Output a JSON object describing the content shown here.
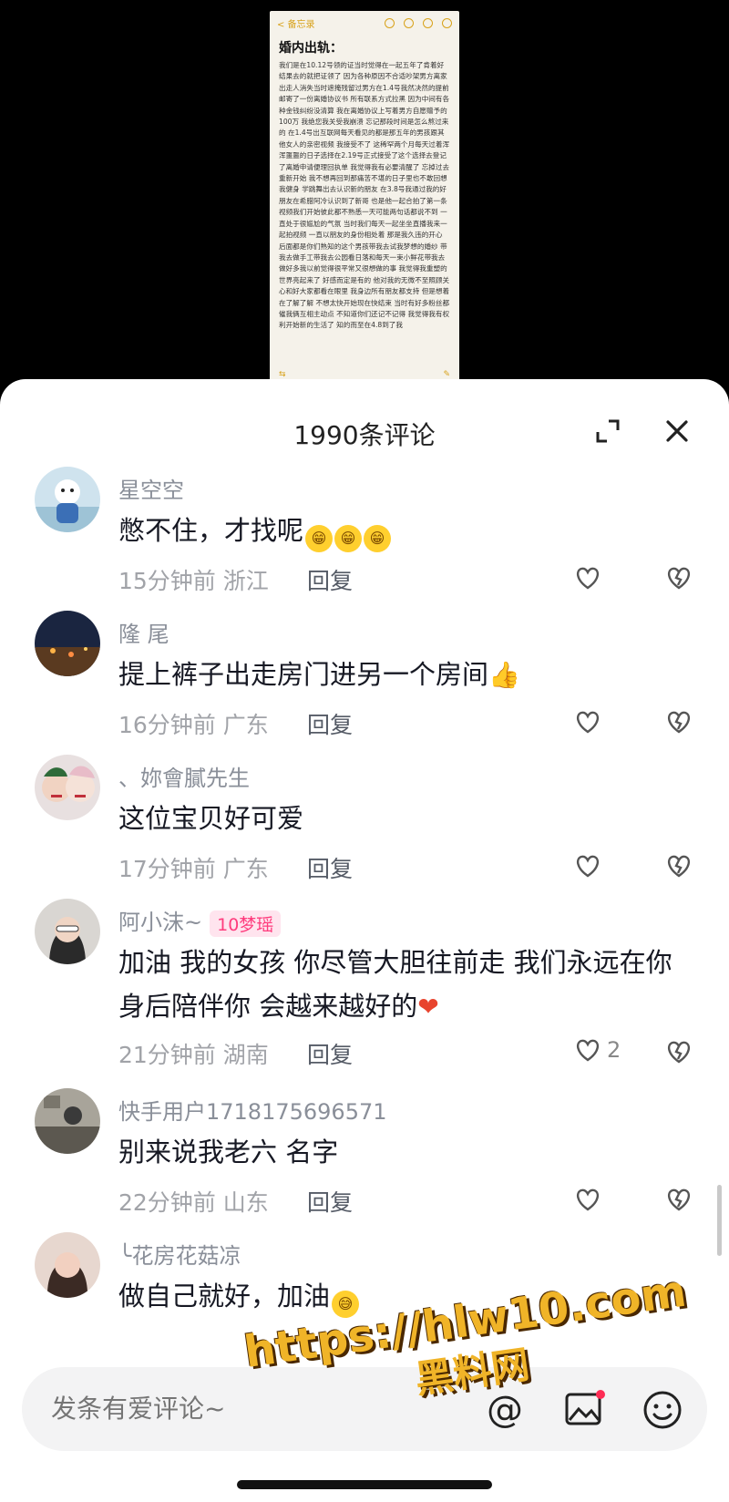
{
  "video": {
    "notes_back": "< 备忘录",
    "notes_title": "婚内出轨：",
    "notes_body": "我们是在10.12号领的证当时觉得在一起五年了肯着好结果去的就把证领了 因为各种原因不合适吵架男方离家出走人消失当时遮掩残留过男方在1.4号我然决然的提前邮寄了一份离婚协议书 所有联系方式拉黑 因为中间有各种金钱纠纷没清算 我在离婚协议上写着男方自愿赠予的100万 我绝您我关受我崩溃 忘记那段时间是怎么熬过来的 在1.4号出互联网每天看见的都是那五年的男孩跟其他女人的亲密视频 我接受不了 这稀罕两个月每天过着浑浑噩噩的日子选择在2.19号正式接受了这个选择去登记了离婚申请便理回执单 我觉得我有必要清醒了 忘掉过去重新开始 我不想再回到那痛苦不堪的日子里也不敢回想 我健身 学跳舞出去认识新的朋友 在3.8号我通过我的好朋友在希腊阿冷认识到了新哥 也是他一起合拍了第一条视频我们开始彼此都不熟悉一天可能两句话都说不到 一直处于很尴尬的气氛 当时我们每天一起坐坐直播我来一起拍视频 一直以朋友的身份相处着 那是我久违的开心 后面都是你们熟知的这个男孩带我去试我梦想的婚纱 带我去做手工带我去公园看日落和每天一束小鲜花带我去做好多我以前觉得很平常又很想做的事 我觉得我重塑的世界亮起来了 好感而定是有的 他对我的无微不至照顾关心和好大家都看在眼里 我身边所有朋友都支持 但是想着在了解了解 不想太快开始现在快结束 当时有好多粉丝都催我俩互相主动点 不知道你们还记不记得 我觉得我有权利开始新的生活了 知的而至在4.8到了我",
    "notes_footer_left": "⇆",
    "notes_footer_right": "✎"
  },
  "panel": {
    "title": "1990条评论"
  },
  "comments": [
    {
      "user": "星空空",
      "text": "憋不住，才找呢",
      "emojis": [
        "😁",
        "😁",
        "😁"
      ],
      "time": "15分钟前",
      "region": "浙江",
      "reply": "回复",
      "likes": ""
    },
    {
      "user": "隆 尾",
      "text": "提上裤子出走房门进另一个房间",
      "emojis": [
        "👍"
      ],
      "time": "16分钟前",
      "region": "广东",
      "reply": "回复",
      "likes": ""
    },
    {
      "user": "、妳會膩先生",
      "text": "这位宝贝好可爱",
      "emojis": [],
      "time": "17分钟前",
      "region": "广东",
      "reply": "回复",
      "likes": ""
    },
    {
      "user": "阿小沫~",
      "badge": "10梦瑶",
      "text": "加油 我的女孩 你尽管大胆往前走 我们永远在你身后陪伴你 会越来越好的",
      "emojis": [
        "❤"
      ],
      "time": "21分钟前",
      "region": "湖南",
      "reply": "回复",
      "likes": "2"
    },
    {
      "user": "快手用户1718175696571",
      "text": "别来说我老六 名字",
      "emojis": [],
      "time": "22分钟前",
      "region": "山东",
      "reply": "回复",
      "likes": ""
    },
    {
      "user": "╰花房花菇凉",
      "text": "做自己就好，加油",
      "emojis": [
        "😅"
      ],
      "time": "",
      "region": "",
      "reply": "",
      "likes": ""
    }
  ],
  "input": {
    "placeholder": "发条有爱评论~",
    "at_symbol": "@"
  },
  "watermark": {
    "url": "https://hlw10.com",
    "name": "黑料网"
  },
  "colors": {
    "accent_badge": "#ff3c7d",
    "notes_yellow": "#d8a21a",
    "watermark": "#f0b428"
  }
}
